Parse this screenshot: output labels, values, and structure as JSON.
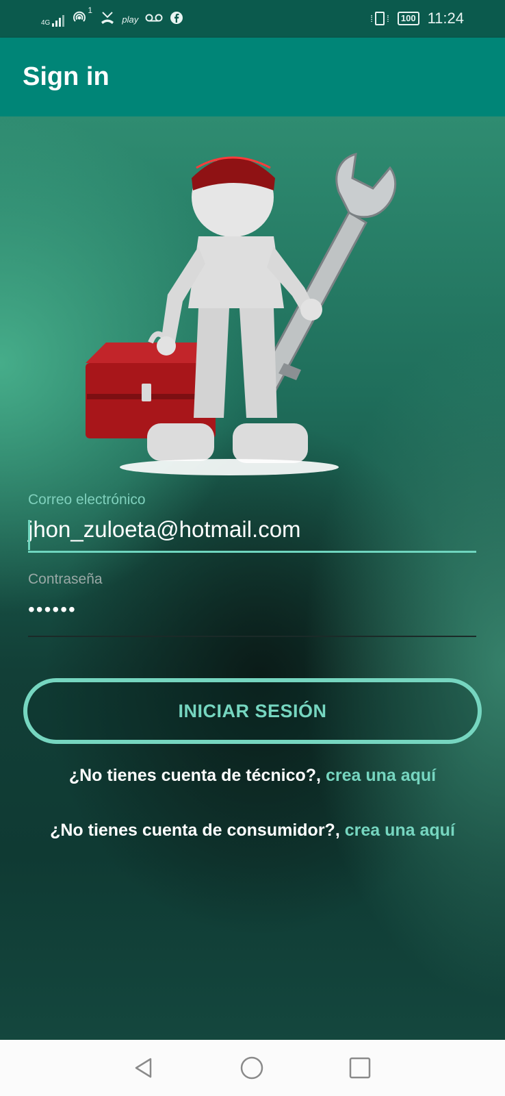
{
  "status_bar": {
    "network": "4G",
    "wifi_badge": "1",
    "play_label": "play",
    "time": "11:24",
    "battery": "100",
    "icons": [
      "signal-icon",
      "hotspot-icon",
      "missed-call-icon",
      "play-icon",
      "voicemail-icon",
      "facebook-icon",
      "vibrate-icon",
      "battery-icon"
    ]
  },
  "app_bar": {
    "title": "Sign in"
  },
  "form": {
    "email_label": "Correo electrónico",
    "email_value": "jhon_zuloeta@hotmail.com",
    "password_label": "Contraseña",
    "password_value": "••••••",
    "login_button": "INICIAR SESIÓN"
  },
  "links": {
    "technician_prompt": "¿No tienes cuenta de técnico?,",
    "technician_link": "crea una aquí",
    "consumer_prompt": "¿No tienes cuenta de consumidor?,",
    "consumer_link": "crea una aquí"
  },
  "colors": {
    "app_bar": "#008577",
    "status_bar": "#0b5a4d",
    "accent": "#76d6c0"
  },
  "nav_bar": {
    "icons": [
      "back-icon",
      "home-icon",
      "recents-icon"
    ]
  }
}
